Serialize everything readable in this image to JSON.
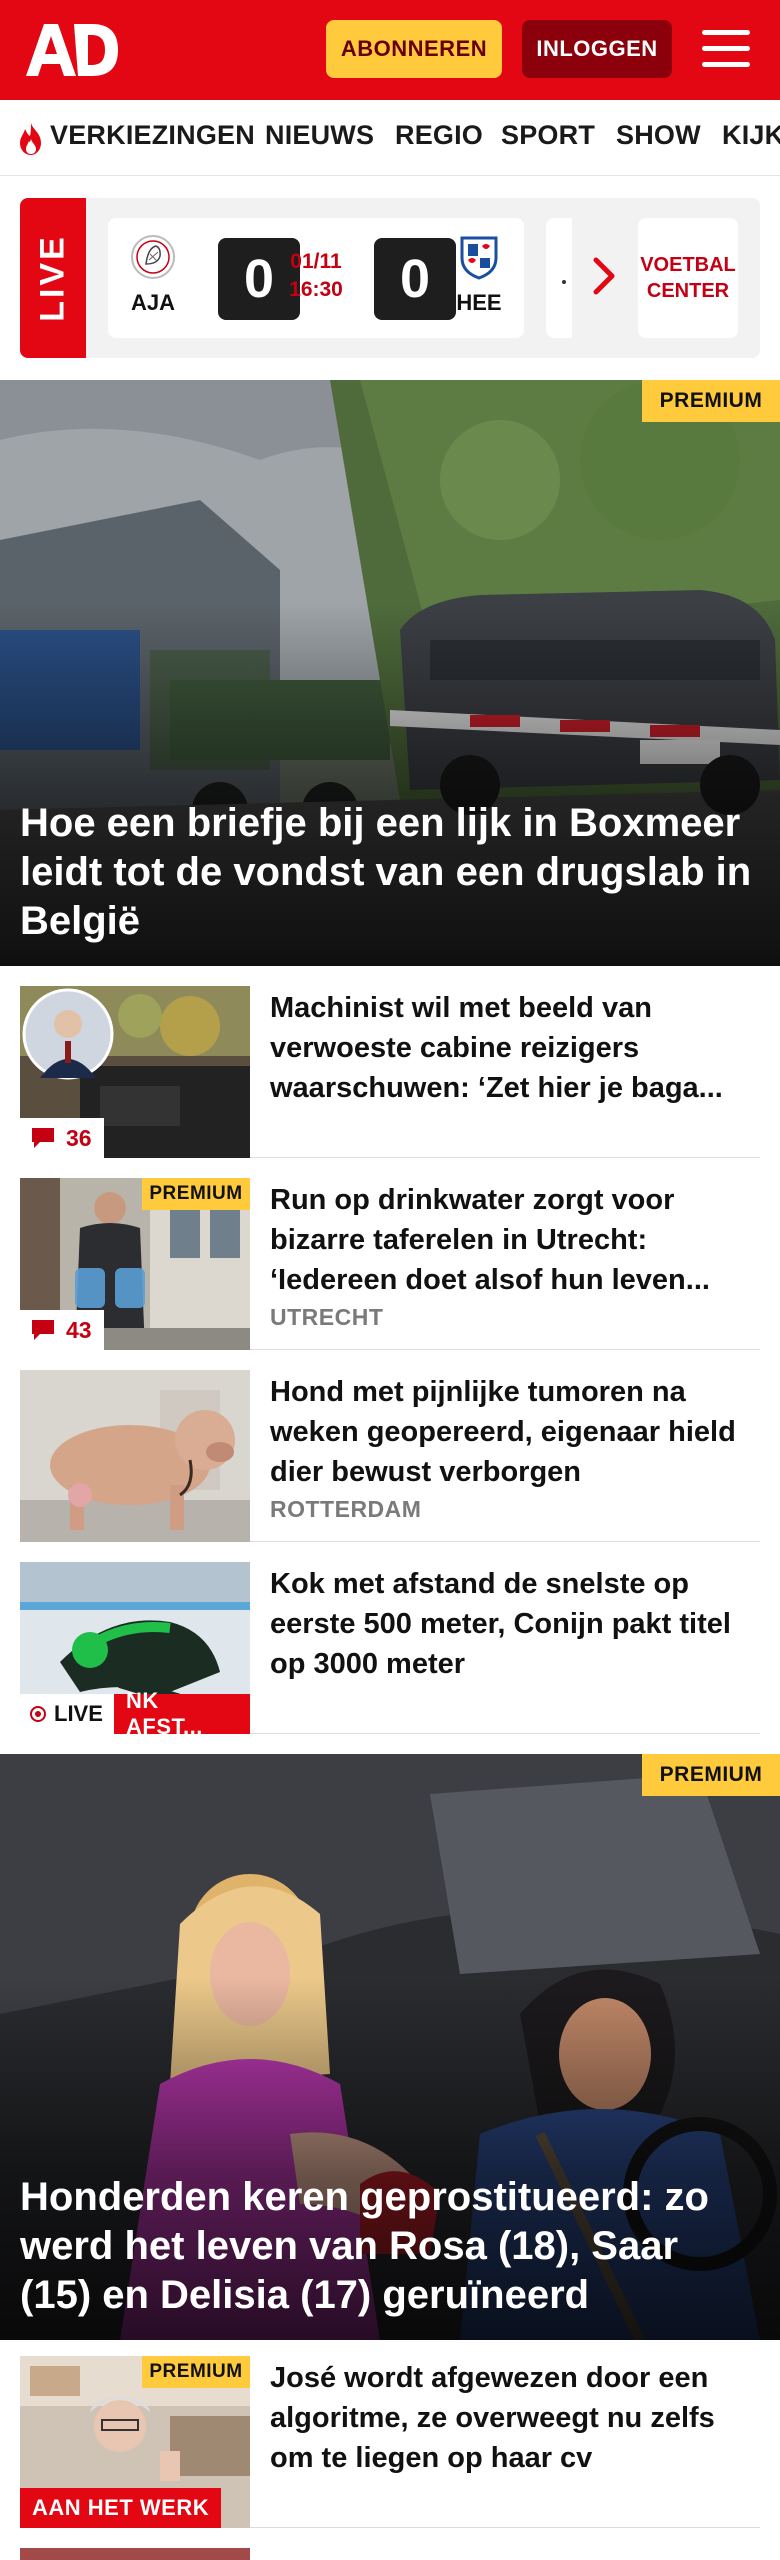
{
  "header": {
    "logo_text": "AD",
    "subscribe_label": "ABONNEREN",
    "login_label": "INLOGGEN",
    "menu_icon": "hamburger-menu-icon"
  },
  "nav": {
    "items": [
      "VERKIEZINGEN",
      "NIEUWS",
      "REGIO",
      "SPORT",
      "SHOW",
      "KIJK"
    ]
  },
  "live": {
    "label": "LIVE",
    "match": {
      "home_team": "AJA",
      "away_team": "HEE",
      "home_score": "0",
      "away_score": "0",
      "date": "01/11",
      "time": "16:30"
    },
    "voetbal_center_label": "VOETBAL CENTER"
  },
  "hero1": {
    "premium_label": "PREMIUM",
    "title": "Hoe een briefje bij een lijk in Boxmeer leidt tot de vondst van een drugslab in België"
  },
  "articles": [
    {
      "title": "Machinist wil met beeld van verwoeste cabine reizigers waarschuwen: ‘Zet hier je baga...",
      "comments": "36"
    },
    {
      "title": "Run op drinkwater zorgt voor bizarre taferelen in Utrecht: ‘Iedereen doet alsof hun leven...",
      "comments": "43",
      "premium_label": "PREMIUM",
      "region": "UTRECHT"
    },
    {
      "title": "Hond met pijnlijke tumoren na weken geopereerd, eigenaar hield dier bewust verborgen",
      "region": "ROTTERDAM"
    },
    {
      "title": "Kok met afstand de snelste op eerste 500 meter, Conijn pakt titel op 3000 meter",
      "live_label": "LIVE",
      "category_label": "NK AFST..."
    }
  ],
  "hero2": {
    "premium_label": "PREMIUM",
    "title": "Honderden keren geprostitueerd: zo werd het leven van Rosa (18), Saar (15) en Delisia (17) geruïneerd"
  },
  "article5": {
    "title": "José wordt afgewezen door een algoritme, ze overweegt nu zelfs om te liegen op haar cv",
    "premium_label": "PREMIUM",
    "category_label": "AAN HET WERK"
  },
  "colors": {
    "brand_red": "#e30613",
    "dark_red": "#8b000b",
    "premium_yellow": "#ffcb3c",
    "meta_grey": "#7a7a7a"
  }
}
